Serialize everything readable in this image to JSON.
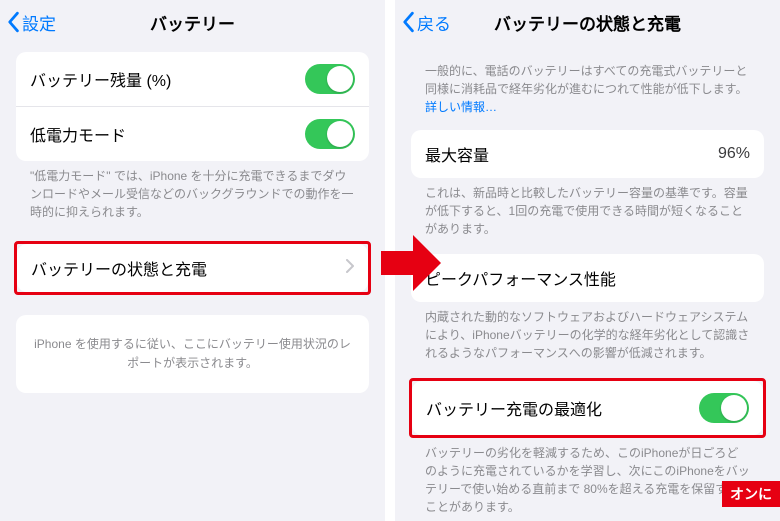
{
  "left": {
    "back": "設定",
    "title": "バッテリー",
    "battery_percent_label": "バッテリー残量 (%)",
    "low_power_label": "低電力モード",
    "low_power_footer": "\"低電力モード\" では、iPhone を十分に充電できるまでダウンロードやメール受信などのバックグラウンドでの動作を一時的に抑えられます。",
    "battery_health_label": "バッテリーの状態と充電",
    "usage_placeholder": "iPhone を使用するに従い、ここにバッテリー使用状況のレポートが表示されます。"
  },
  "right": {
    "back": "戻る",
    "title": "バッテリーの状態と充電",
    "intro": "一般的に、電話のバッテリーはすべての充電式バッテリーと同様に消耗品で経年劣化が進むにつれて性能が低下します。",
    "intro_link": "詳しい情報…",
    "max_capacity_label": "最大容量",
    "max_capacity_value": "96%",
    "max_capacity_footer": "これは、新品時と比較したバッテリー容量の基準です。容量が低下すると、1回の充電で使用できる時間が短くなることがあります。",
    "peak_performance_label": "ピークパフォーマンス性能",
    "peak_performance_footer": "内蔵された動的なソフトウェアおよびハードウェアシステムにより、iPhoneバッテリーの化学的な経年劣化として認識されるようなパフォーマンスへの影響が低減されます。",
    "optimized_label": "バッテリー充電の最適化",
    "optimized_footer": "バッテリーの劣化を軽減するため、このiPhoneが日ごろどのように充電されているかを学習し、次にこのiPhoneをバッテリーで使い始める直前まで 80%を超える充電を保留することがあります。"
  },
  "badge": "オンに"
}
